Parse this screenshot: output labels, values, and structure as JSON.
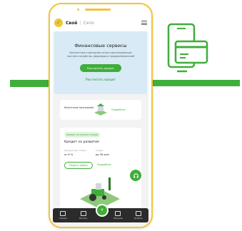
{
  "colors": {
    "accent": "#3fae3a",
    "brand_yellow": "#f2c534",
    "hero_bg": "#d7eaf5"
  },
  "header": {
    "brand": "Своё",
    "brand_sub": "Село",
    "menu_icon": "hamburger-icon"
  },
  "hero": {
    "title": "Финансовые сервисы",
    "text": "Бесплатные и выгодные услуги для владельцев частного хозяйства, фермеров и предпринимателей",
    "button_label": "Рассчитать кредит",
    "link_label": "Рассчитать кредит"
  },
  "card1": {
    "label": "Ипотечные программы",
    "link": "Подробнее"
  },
  "card2": {
    "badge": "Кредит на сельхоз нужды",
    "title": "Кредит на развитие",
    "label1": "Процентная ставка",
    "value1": "от 6 %",
    "label2": "Сумма",
    "value2": "до 30 млн",
    "button_label": "Подать заявку",
    "link_label": "Подробнее"
  },
  "tabbar": {
    "items": [
      {
        "label": "Главная",
        "icon": "home-icon"
      },
      {
        "label": "Магазин",
        "icon": "shop-icon"
      },
      {
        "label": "",
        "icon": "plus-icon"
      },
      {
        "label": "Обучение",
        "icon": "learning-icon"
      },
      {
        "label": "Профиль",
        "icon": "profile-icon"
      }
    ]
  }
}
